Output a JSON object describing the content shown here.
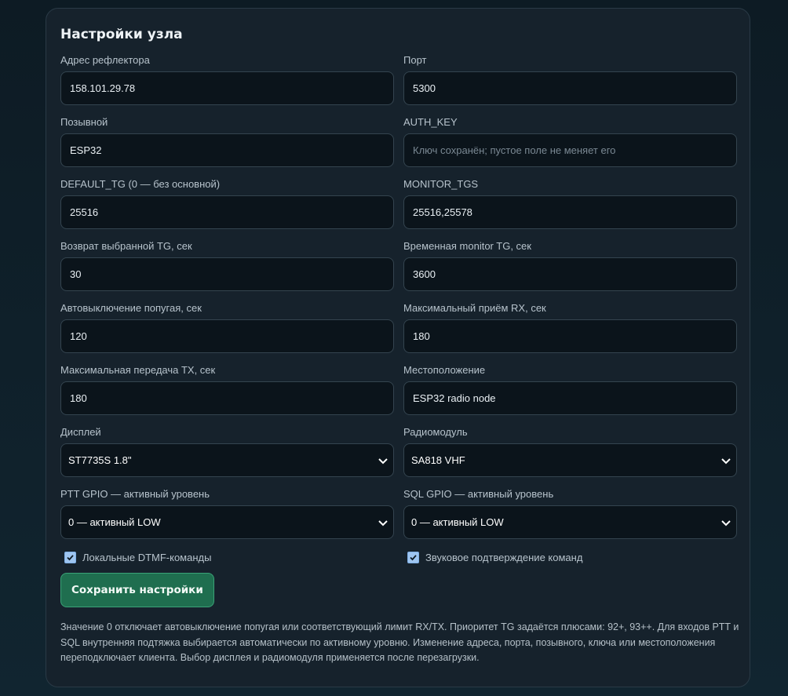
{
  "panel": {
    "title": "Настройки узла",
    "fields": [
      {
        "label": "Адрес рефлектора",
        "value": "158.101.29.78",
        "placeholder": ""
      },
      {
        "label": "Порт",
        "value": "5300",
        "placeholder": ""
      },
      {
        "label": "Позывной",
        "value": "ESP32",
        "placeholder": ""
      },
      {
        "label": "AUTH_KEY",
        "value": "",
        "placeholder": "Ключ сохранён; пустое поле не меняет его"
      },
      {
        "label": "DEFAULT_TG (0 — без основной)",
        "value": "25516",
        "placeholder": ""
      },
      {
        "label": "MONITOR_TGS",
        "value": "25516,25578",
        "placeholder": ""
      },
      {
        "label": "Возврат выбранной TG, сек",
        "value": "30",
        "placeholder": ""
      },
      {
        "label": "Временная monitor TG, сек",
        "value": "3600",
        "placeholder": ""
      },
      {
        "label": "Автовыключение попугая, сек",
        "value": "120",
        "placeholder": ""
      },
      {
        "label": "Максимальный приём RX, сек",
        "value": "180",
        "placeholder": ""
      },
      {
        "label": "Максимальная передача TX, сек",
        "value": "180",
        "placeholder": ""
      },
      {
        "label": "Местоположение",
        "value": "ESP32 radio node",
        "placeholder": ""
      }
    ],
    "selects": [
      {
        "label": "Дисплей",
        "value": "ST7735S 1.8\""
      },
      {
        "label": "Радиомодуль",
        "value": "SA818 VHF"
      },
      {
        "label": "PTT GPIO — активный уровень",
        "value": "0 — активный LOW"
      },
      {
        "label": "SQL GPIO — активный уровень",
        "value": "0 — активный LOW"
      }
    ],
    "checkboxes": [
      {
        "label": "Локальные DTMF-команды",
        "checked": true
      },
      {
        "label": "Звуковое подтверждение команд",
        "checked": true
      }
    ],
    "save_label": "Сохранить настройки",
    "note": "Значение 0 отключает автовыключение попугая или соответствующий лимит RX/TX. Приоритет TG задаётся плюсами: 92+, 93++. Для входов PTT и SQL внутренняя подтяжка выбирается автоматически по активному уровню. Изменение адреса, порта, позывного, ключа или местоположения переподключает клиента. Выбор дисплея и радиомодуля применяется после перезагрузки."
  },
  "colors": {
    "background": "#0d1b24",
    "panel": "#16222c",
    "input_bg": "#0b141b",
    "accent_button": "#1f6e4f",
    "checkbox": "#9ec5f0"
  }
}
